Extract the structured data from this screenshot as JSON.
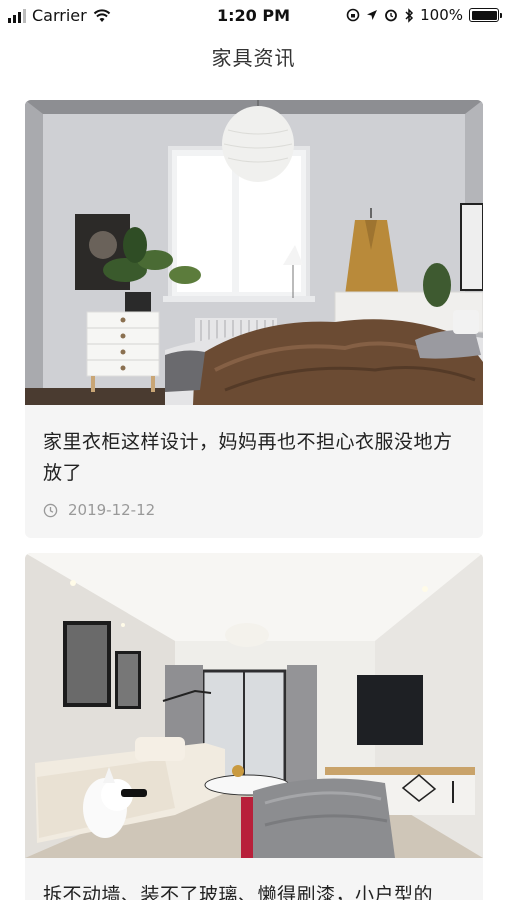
{
  "status_bar": {
    "carrier": "Carrier",
    "time": "1:20 PM",
    "battery": "100%",
    "icons": [
      "signal-icon",
      "wifi-icon",
      "screen-lock-icon",
      "location-icon",
      "alarm-icon",
      "bluetooth-icon",
      "battery-icon"
    ]
  },
  "header": {
    "title": "家具资讯"
  },
  "articles": [
    {
      "title": "家里衣柜这样设计，妈妈再也不担心衣服没地方放了",
      "date": "2019-12-12",
      "image": "bedroom-photo"
    },
    {
      "title": "拆不动墙、装不了玻璃、懒得刷漆，小户型的",
      "date": "",
      "image": "living-room-photo"
    }
  ],
  "colors": {
    "card_bg": "#f5f5f5",
    "date_text": "#999999",
    "title_text": "#222222"
  }
}
